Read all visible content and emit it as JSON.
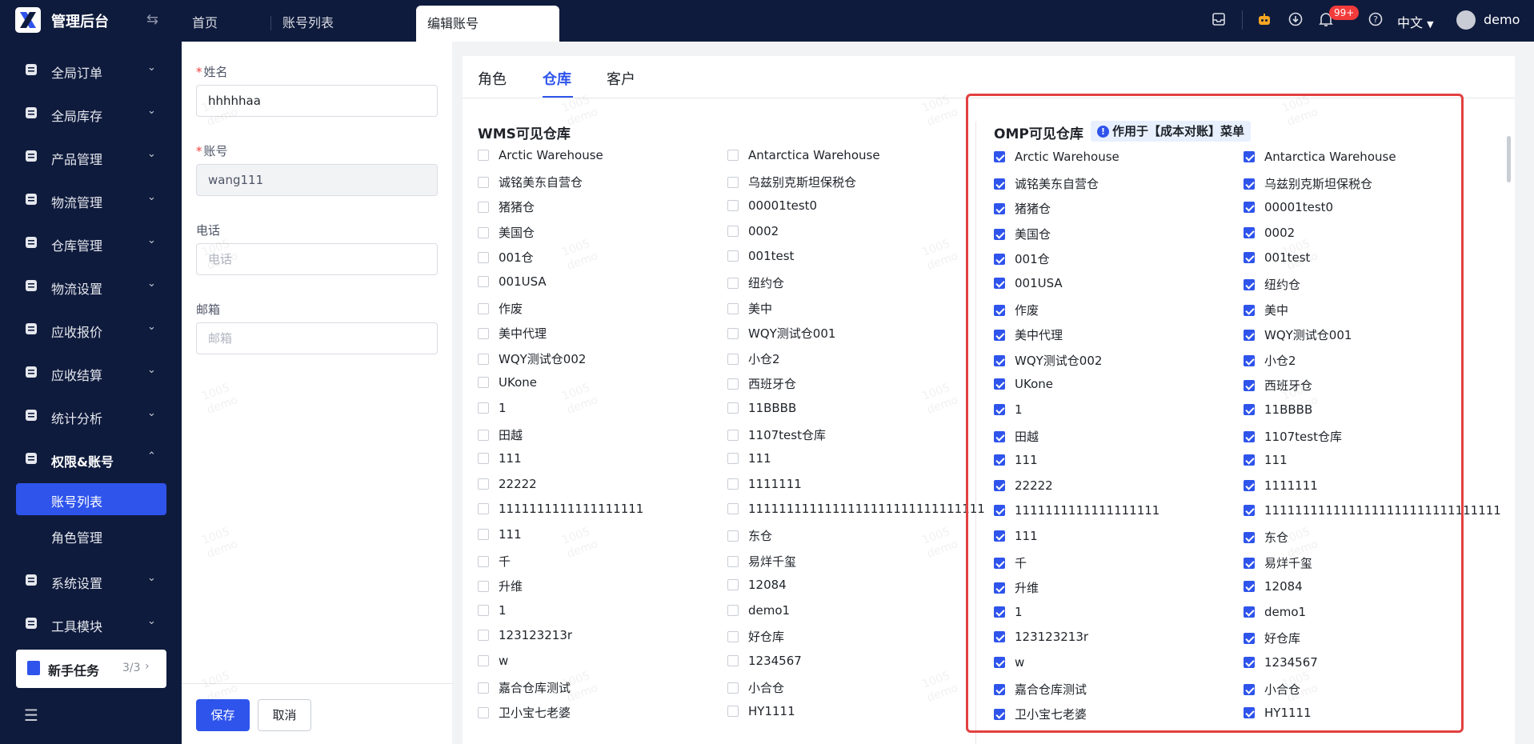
{
  "app": {
    "title": "管理后台"
  },
  "top_tabs": {
    "home": "首页",
    "account_list": "账号列表",
    "edit_account": "编辑账号"
  },
  "header": {
    "notification_count": "99+",
    "language": "中文",
    "username": "demo"
  },
  "sidebar": {
    "items": [
      {
        "label": "全局订单",
        "icon": "order-icon"
      },
      {
        "label": "全局库存",
        "icon": "inventory-icon"
      },
      {
        "label": "产品管理",
        "icon": "product-icon"
      },
      {
        "label": "物流管理",
        "icon": "truck-icon"
      },
      {
        "label": "仓库管理",
        "icon": "warehouse-icon"
      },
      {
        "label": "物流设置",
        "icon": "logistics-settings-icon"
      },
      {
        "label": "应收报价",
        "icon": "quote-icon"
      },
      {
        "label": "应收结算",
        "icon": "settlement-icon"
      },
      {
        "label": "统计分析",
        "icon": "chart-icon"
      },
      {
        "label": "权限&账号",
        "icon": "org-icon"
      },
      {
        "label": "系统设置",
        "icon": "settings-icon"
      },
      {
        "label": "工具模块",
        "icon": "tool-icon"
      }
    ],
    "submenu_active": "账号列表",
    "submenu_item": "角色管理",
    "task": {
      "label": "新手任务",
      "count": "3/3"
    }
  },
  "form": {
    "name_label": "姓名",
    "name_value": "hhhhhaa",
    "account_label": "账号",
    "account_value": "wang111",
    "phone_label": "电话",
    "phone_placeholder": "电话",
    "email_label": "邮箱",
    "email_placeholder": "邮箱",
    "save_label": "保存",
    "cancel_label": "取消"
  },
  "content_tabs": {
    "role": "角色",
    "warehouse": "仓库",
    "customer": "客户"
  },
  "wms": {
    "title": "WMS可见仓库"
  },
  "omp": {
    "title": "OMP可见仓库",
    "hint": "作用于【成本对账】菜单"
  },
  "warehouses_left": [
    "Arctic Warehouse",
    "诚铭美东自营仓",
    "猪猪仓",
    "美国仓",
    "001仓",
    "001USA",
    "作废",
    "美中代理",
    "WQY测试仓002",
    "UKone",
    "1",
    "田越",
    "111",
    "22222",
    "1111111111111111111",
    "111",
    "千",
    "升维",
    "1",
    "123123213r",
    "w",
    "嘉合仓库测试",
    "卫小宝七老婆"
  ],
  "warehouses_right": [
    "Antarctica Warehouse",
    "乌兹别克斯坦保税仓",
    "00001test0",
    "0002",
    "001test",
    "纽约仓",
    "美中",
    "WQY测试仓001",
    "小仓2",
    "西班牙仓",
    "11BBBB",
    "1107test仓库",
    "111",
    "1111111",
    "1111111111111111111111111111111",
    "东仓",
    "易烊千玺",
    "12084",
    "demo1",
    "好仓库",
    "1234567",
    "小合仓",
    "HY1111"
  ],
  "watermark": {
    "line1": "1005",
    "line2": "demo"
  },
  "colors": {
    "primary": "#2f54eb",
    "sidebar": "#0f1b3d",
    "highlight": "#e34040"
  }
}
